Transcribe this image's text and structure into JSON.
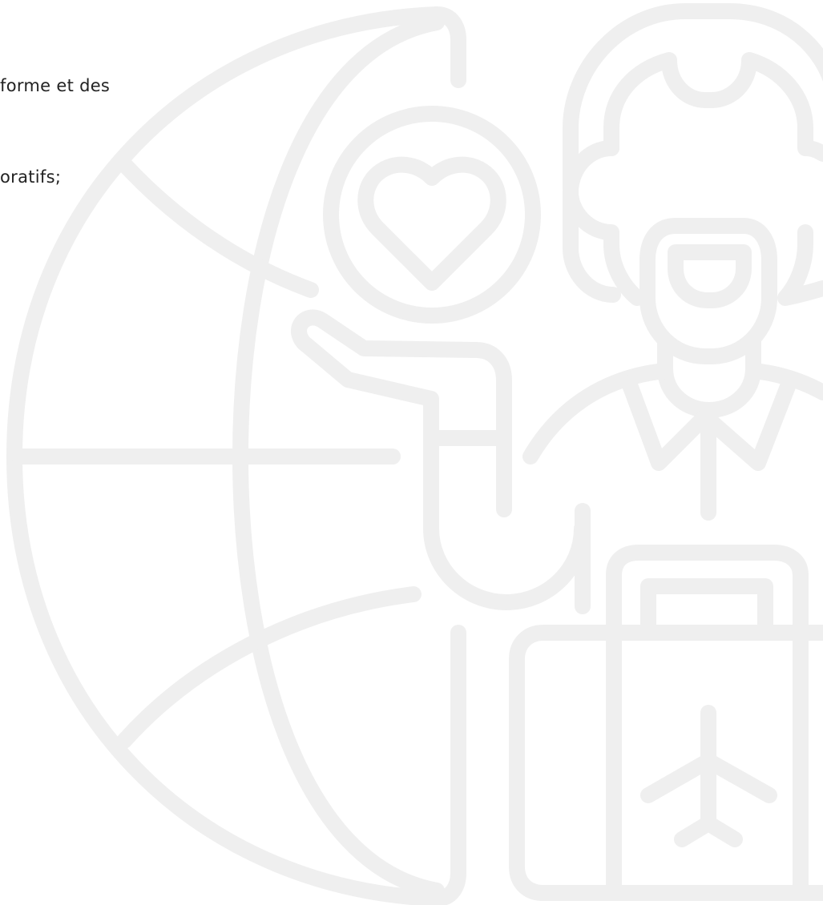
{
  "text_fragment": {
    "line1": "forme et des",
    "line2": "oratifs;"
  },
  "illustration": {
    "stroke_color": "#efefef",
    "icons": [
      "globe-icon",
      "heart-bubble-icon",
      "traveler-icon",
      "suitcase-icon",
      "airplane-icon"
    ]
  }
}
